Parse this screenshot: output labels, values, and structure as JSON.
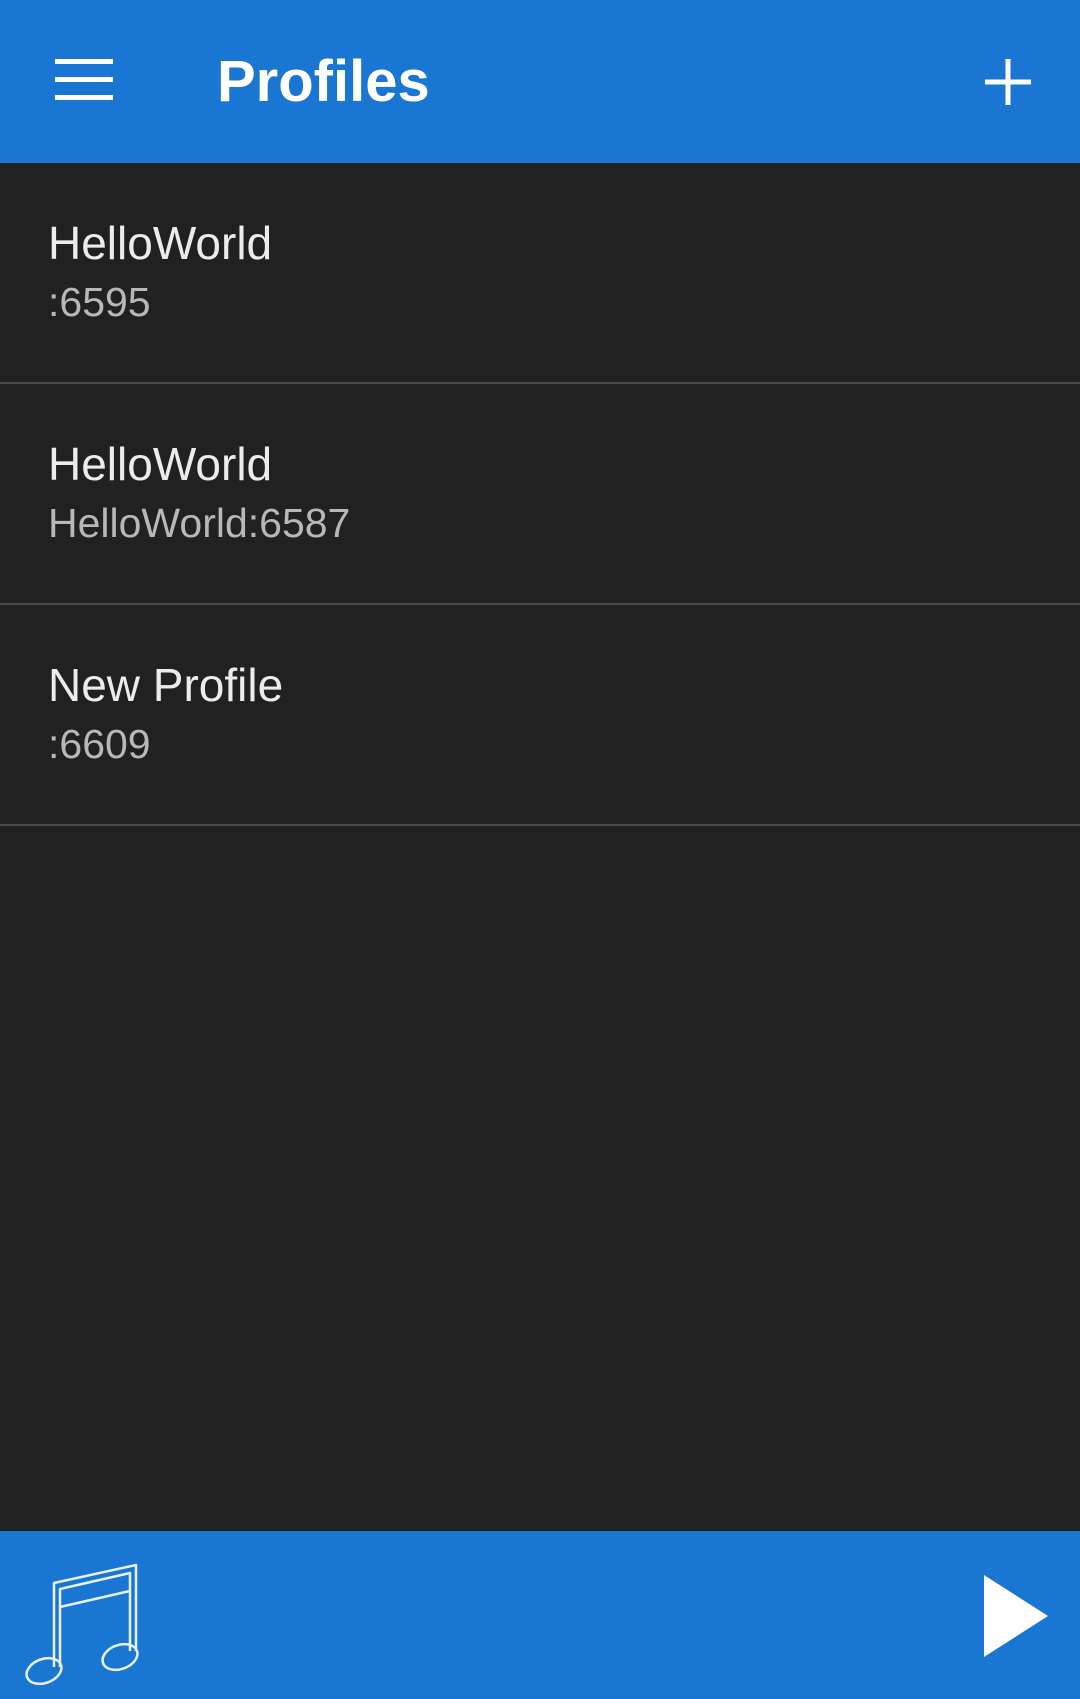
{
  "header": {
    "title": "Profiles",
    "menu_icon": "hamburger-menu-icon",
    "add_icon": "plus-icon"
  },
  "profiles": [
    {
      "name": "HelloWorld",
      "address": ":6595"
    },
    {
      "name": "HelloWorld",
      "address": "HelloWorld:6587"
    },
    {
      "name": "New Profile",
      "address": ":6609"
    }
  ],
  "bottom_bar": {
    "music_icon": "music-note-icon",
    "play_icon": "play-icon"
  },
  "colors": {
    "primary": "#1976D2",
    "background": "#212121",
    "divider": "#4a4a4a",
    "title_text": "#ececec",
    "subtitle_text": "#b8b8b8"
  }
}
